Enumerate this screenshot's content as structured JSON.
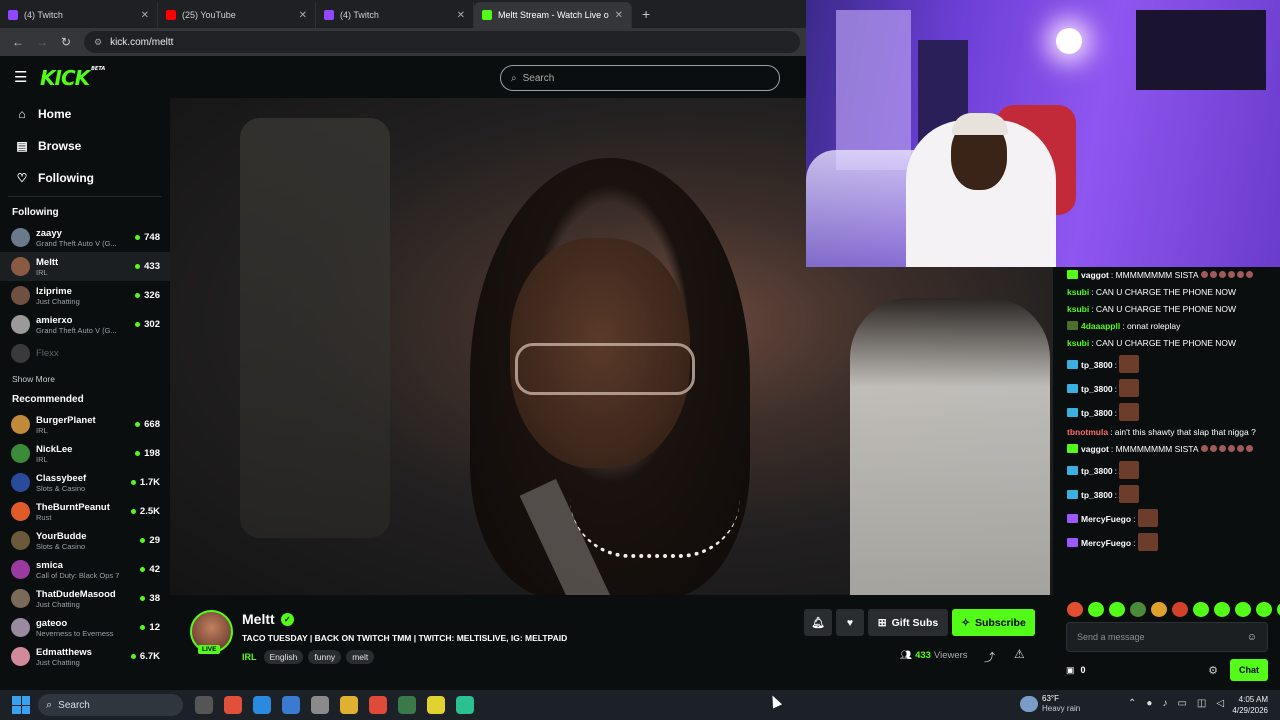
{
  "browser": {
    "tabs": [
      {
        "label": "(4) Twitch",
        "color": "#9146ff"
      },
      {
        "label": "(25) YouTube",
        "color": "#ff0000"
      },
      {
        "label": "(4) Twitch",
        "color": "#9146ff"
      },
      {
        "label": "Meltt Stream - Watch Live o",
        "color": "#53fc18"
      }
    ],
    "url": "kick.com/meltt",
    "new_tab": "+"
  },
  "header": {
    "logo": "KICK",
    "logo_badge": "BETA",
    "search_placeholder": "Search"
  },
  "nav": {
    "home": "Home",
    "browse": "Browse",
    "following": "Following"
  },
  "following": {
    "title": "Following",
    "channels": [
      {
        "name": "zaayy",
        "game": "Grand Theft Auto V (G...",
        "viewers": "748",
        "color": "#6a7a8a"
      },
      {
        "name": "Meltt",
        "game": "IRL",
        "viewers": "433",
        "color": "#8a5a44"
      },
      {
        "name": "Iziprime",
        "game": "Just Chatting",
        "viewers": "326",
        "color": "#705040"
      },
      {
        "name": "amierxo",
        "game": "Grand Theft Auto V (G...",
        "viewers": "302",
        "color": "#9a9a9a"
      },
      {
        "name": "Flexx",
        "game": "",
        "viewers": "",
        "color": "#3a3a3a"
      }
    ],
    "show_more": "Show More"
  },
  "recommended": {
    "title": "Recommended",
    "channels": [
      {
        "name": "BurgerPlanet",
        "game": "IRL",
        "viewers": "668",
        "color": "#c08a3a"
      },
      {
        "name": "NickLee",
        "game": "IRL",
        "viewers": "198",
        "color": "#3a8a3a"
      },
      {
        "name": "Classybeef",
        "game": "Slots & Casino",
        "viewers": "1.7K",
        "color": "#2a4a9a"
      },
      {
        "name": "TheBurntPeanut",
        "game": "Rust",
        "viewers": "2.5K",
        "color": "#e05a2a"
      },
      {
        "name": "YourBudde",
        "game": "Slots & Casino",
        "viewers": "29",
        "color": "#6a5a3a"
      },
      {
        "name": "smica",
        "game": "Call of Duty: Black Ops 7",
        "viewers": "42",
        "color": "#9a3aa0"
      },
      {
        "name": "ThatDudeMasood",
        "game": "Just Chatting",
        "viewers": "38",
        "color": "#7a6a5a"
      },
      {
        "name": "gateoo",
        "game": "Neverness to Everness",
        "viewers": "12",
        "color": "#9a8aa0"
      },
      {
        "name": "Edmatthews",
        "game": "Just Chatting",
        "viewers": "6.7K",
        "color": "#d08a9a"
      }
    ]
  },
  "chat": {
    "messages": [
      {
        "user": "vaggot",
        "text": ": MMMMMMMM SISTA",
        "user_color": "#ffffff",
        "badge": "g",
        "minis": 6
      },
      {
        "user": "ksubi",
        "text": ": CAN U CHARGE THE PHONE NOW",
        "user_color": "#53fc18",
        "badge": "",
        "minis": 0
      },
      {
        "user": "ksubi",
        "text": ": CAN U CHARGE THE PHONE NOW",
        "user_color": "#53fc18",
        "badge": "",
        "minis": 0
      },
      {
        "user": "4daaappll",
        "text": ": onnat roleplay",
        "user_color": "#53fc18",
        "badge": "o",
        "minis": 0
      },
      {
        "user": "ksubi",
        "text": ": CAN U CHARGE THE PHONE NOW",
        "user_color": "#53fc18",
        "badge": "",
        "minis": 0
      },
      {
        "user": "tp_3800",
        "text": ":",
        "user_color": "#ffffff",
        "badge": "b",
        "emote": true
      },
      {
        "user": "tp_3800",
        "text": ":",
        "user_color": "#ffffff",
        "badge": "b",
        "emote": true
      },
      {
        "user": "tp_3800",
        "text": ":",
        "user_color": "#ffffff",
        "badge": "b",
        "emote": true
      },
      {
        "user": "tbnotmula",
        "text": ": ain't this shawty that slap that nigga ?",
        "user_color": "#ff6b6b",
        "badge": "",
        "minis": 0
      },
      {
        "user": "vaggot",
        "text": ": MMMMMMMM SISTA",
        "user_color": "#ffffff",
        "badge": "g",
        "minis": 6
      },
      {
        "user": "tp_3800",
        "text": ":",
        "user_color": "#ffffff",
        "badge": "b",
        "emote": true
      },
      {
        "user": "tp_3800",
        "text": ":",
        "user_color": "#ffffff",
        "badge": "b",
        "emote": true
      },
      {
        "user": "MercyFuego",
        "text": ":",
        "user_color": "#ffffff",
        "badge": "p",
        "emote": true
      },
      {
        "user": "MercyFuego",
        "text": ":",
        "user_color": "#ffffff",
        "badge": "p",
        "emote": true
      }
    ],
    "emote_colors": [
      "#e05030",
      "#53fc18",
      "#53fc18",
      "#4a8a3a",
      "#e0a030",
      "#d0402a",
      "#53fc18",
      "#53fc18",
      "#53fc18",
      "#53fc18",
      "#53fc18",
      "#e07a50"
    ],
    "input_placeholder": "Send a message",
    "count": "0",
    "chat_button": "Chat"
  },
  "stream": {
    "name": "Meltt",
    "live": "LIVE",
    "title": "TACO TUESDAY | BACK ON TWITCH TMM | TWITCH: MELTISLIVE, IG: MELTPAID",
    "category": "IRL",
    "tags": [
      "English",
      "funny",
      "melt"
    ],
    "gift_subs": "Gift Subs",
    "subscribe": "Subscribe",
    "viewers": "433",
    "viewers_label": "Viewers"
  },
  "taskbar": {
    "search": "Search",
    "weather_temp": "63°F",
    "weather_desc": "Heavy rain",
    "time": "4:05 AM",
    "date": "4/29/2026",
    "app_colors": [
      "#555",
      "#e0503a",
      "#2a8ae0",
      "#3a7ad0",
      "#8a8a8a",
      "#e0b030",
      "#e04a3a",
      "#3a7a4a",
      "#e0d030",
      "#2ac090"
    ]
  }
}
